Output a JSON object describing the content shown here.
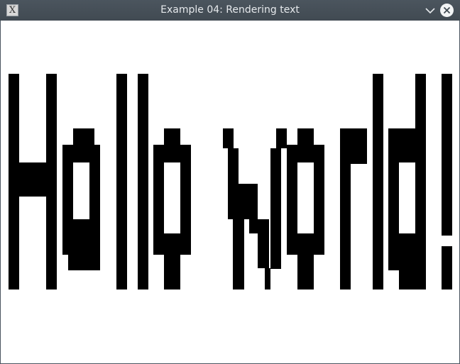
{
  "window": {
    "title": "Example 04: Rendering text",
    "app_icon_glyph": "X"
  },
  "canvas": {
    "text": "Hello world!",
    "text_color": "#000000",
    "background_color": "#ffffff"
  }
}
